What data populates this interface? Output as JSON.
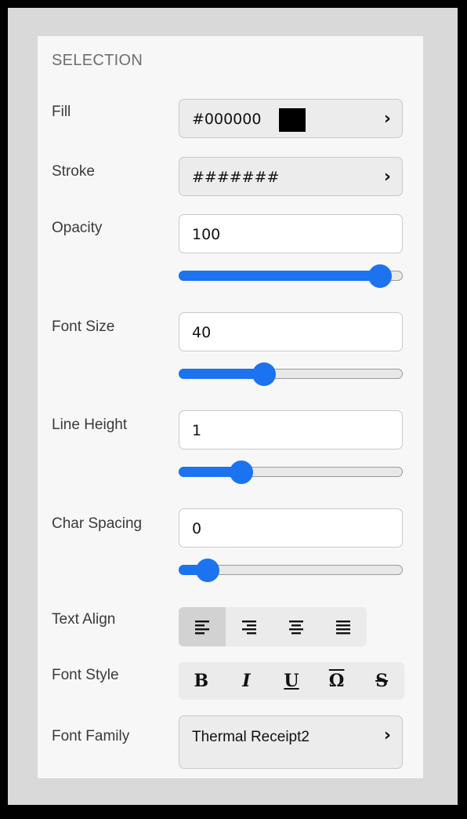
{
  "panel": {
    "title": "SELECTION"
  },
  "fill": {
    "label": "Fill",
    "value": "#000000",
    "swatch_color": "#000000"
  },
  "stroke": {
    "label": "Stroke",
    "value": "#######"
  },
  "opacity": {
    "label": "Opacity",
    "value": "100",
    "slider_fraction": 0.9
  },
  "font_size": {
    "label": "Font Size",
    "value": "40",
    "slider_fraction": 0.38
  },
  "line_height": {
    "label": "Line Height",
    "value": "1",
    "slider_fraction": 0.28
  },
  "char_spacing": {
    "label": "Char Spacing",
    "value": "0",
    "slider_fraction": 0.13
  },
  "text_align": {
    "label": "Text Align",
    "selected": "left"
  },
  "font_style": {
    "label": "Font Style",
    "bold": "B",
    "italic": "I",
    "underline": "U",
    "overline": "Ω",
    "strike": "S"
  },
  "font_family": {
    "label": "Font Family",
    "value": "Thermal Receipt2"
  },
  "colors": {
    "accent": "#1b73f0",
    "panel_bg": "#f7f7f7",
    "frame": "#d9d9d9"
  },
  "icons": {
    "chevron": "chevron-right-icon"
  }
}
